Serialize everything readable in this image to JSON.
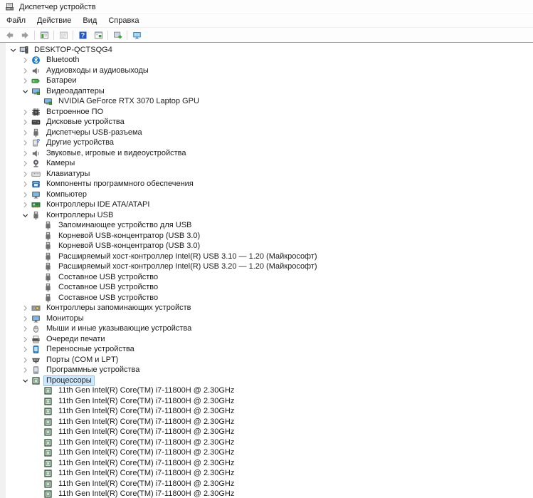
{
  "window": {
    "title": "Диспетчер устройств"
  },
  "menu": {
    "items": [
      {
        "name": "menu-file",
        "label": "Файл"
      },
      {
        "name": "menu-action",
        "label": "Действие"
      },
      {
        "name": "menu-view",
        "label": "Вид"
      },
      {
        "name": "menu-help",
        "label": "Справка"
      }
    ]
  },
  "toolbar": {
    "buttons": [
      {
        "type": "button",
        "name": "back-button",
        "icon": "back-arrow-icon",
        "disabled": true
      },
      {
        "type": "button",
        "name": "forward-button",
        "icon": "forward-arrow-icon",
        "disabled": true
      },
      {
        "type": "sep"
      },
      {
        "type": "button",
        "name": "console-tree-button",
        "icon": "console-tree-icon",
        "disabled": false
      },
      {
        "type": "sep"
      },
      {
        "type": "button",
        "name": "properties-button",
        "icon": "properties-disabled-icon",
        "disabled": true
      },
      {
        "type": "sep"
      },
      {
        "type": "button",
        "name": "help-button",
        "icon": "help-icon",
        "disabled": false
      },
      {
        "type": "button",
        "name": "properties-window-button",
        "icon": "properties-window-icon",
        "disabled": false
      },
      {
        "type": "sep"
      },
      {
        "type": "button",
        "name": "scan-hardware-button",
        "icon": "scan-hardware-icon",
        "disabled": false
      },
      {
        "type": "sep"
      },
      {
        "type": "button",
        "name": "device-monitor-button",
        "icon": "device-monitor-icon",
        "disabled": false
      }
    ]
  },
  "colors": {
    "selection_bg": "#cce8ff",
    "selection_border": "#8ec8f2",
    "toolbar_divider": "#9b9b9b",
    "help_blue": "#2457c5",
    "tree_bg": "#ffffff"
  },
  "tree": {
    "rows": [
      {
        "name": "desktop-qctsqg4",
        "label": "DESKTOP-QCTSQG4",
        "level": 0,
        "chevron": "expanded",
        "icon": "computer-icon"
      },
      {
        "name": "bluetooth",
        "label": "Bluetooth",
        "level": 1,
        "chevron": "collapsed",
        "icon": "bluetooth-icon"
      },
      {
        "name": "audio-inputs-outputs",
        "label": "Аудиовходы и аудиовыходы",
        "level": 1,
        "chevron": "collapsed",
        "icon": "audio-icon"
      },
      {
        "name": "batteries",
        "label": "Батареи",
        "level": 1,
        "chevron": "collapsed",
        "icon": "battery-icon"
      },
      {
        "name": "display-adapters",
        "label": "Видеоадаптеры",
        "level": 1,
        "chevron": "expanded",
        "icon": "display-adapter-icon"
      },
      {
        "name": "nvidia-rtx-3070",
        "label": "NVIDIA GeForce RTX 3070 Laptop GPU",
        "level": 2,
        "chevron": "none",
        "icon": "display-adapter-icon"
      },
      {
        "name": "firmware",
        "label": "Встроенное ПО",
        "level": 1,
        "chevron": "collapsed",
        "icon": "firmware-icon"
      },
      {
        "name": "disk-drives",
        "label": "Дисковые устройства",
        "level": 1,
        "chevron": "collapsed",
        "icon": "disk-drive-icon"
      },
      {
        "name": "usb-connector-managers",
        "label": "Диспетчеры USB-разъема",
        "level": 1,
        "chevron": "collapsed",
        "icon": "usb-icon"
      },
      {
        "name": "other-devices",
        "label": "Другие устройства",
        "level": 1,
        "chevron": "collapsed",
        "icon": "unknown-device-icon"
      },
      {
        "name": "sound-video-game",
        "label": "Звуковые, игровые и видеоустройства",
        "level": 1,
        "chevron": "collapsed",
        "icon": "audio-icon"
      },
      {
        "name": "cameras",
        "label": "Камеры",
        "level": 1,
        "chevron": "collapsed",
        "icon": "camera-icon"
      },
      {
        "name": "keyboards",
        "label": "Клавиатуры",
        "level": 1,
        "chevron": "collapsed",
        "icon": "keyboard-icon"
      },
      {
        "name": "software-components",
        "label": "Компоненты программного обеспечения",
        "level": 1,
        "chevron": "collapsed",
        "icon": "software-component-icon"
      },
      {
        "name": "computer",
        "label": "Компьютер",
        "level": 1,
        "chevron": "collapsed",
        "icon": "monitor-icon"
      },
      {
        "name": "ide-controllers",
        "label": "Контроллеры IDE ATA/ATAPI",
        "level": 1,
        "chevron": "collapsed",
        "icon": "ide-controller-icon"
      },
      {
        "name": "usb-controllers",
        "label": "Контроллеры USB",
        "level": 1,
        "chevron": "expanded",
        "icon": "usb-icon"
      },
      {
        "name": "usb-storage-device",
        "label": "Запоминающее устройство для USB",
        "level": 2,
        "chevron": "none",
        "icon": "usb-icon"
      },
      {
        "name": "usb-root-hub-1",
        "label": "Корневой USB-концентратор (USB 3.0)",
        "level": 2,
        "chevron": "none",
        "icon": "usb-icon"
      },
      {
        "name": "usb-root-hub-2",
        "label": "Корневой USB-концентратор (USB 3.0)",
        "level": 2,
        "chevron": "none",
        "icon": "usb-icon"
      },
      {
        "name": "usb-xhci-310",
        "label": "Расширяемый хост-контроллер Intel(R) USB 3.10 — 1.20 (Майкрософт)",
        "level": 2,
        "chevron": "none",
        "icon": "usb-icon"
      },
      {
        "name": "usb-xhci-320",
        "label": "Расширяемый хост-контроллер Intel(R) USB 3.20 — 1.20 (Майкрософт)",
        "level": 2,
        "chevron": "none",
        "icon": "usb-icon"
      },
      {
        "name": "usb-composite-1",
        "label": "Составное USB устройство",
        "level": 2,
        "chevron": "none",
        "icon": "usb-icon"
      },
      {
        "name": "usb-composite-2",
        "label": "Составное USB устройство",
        "level": 2,
        "chevron": "none",
        "icon": "usb-icon"
      },
      {
        "name": "usb-composite-3",
        "label": "Составное USB устройство",
        "level": 2,
        "chevron": "none",
        "icon": "usb-icon"
      },
      {
        "name": "storage-controllers",
        "label": "Контроллеры запоминающих устройств",
        "level": 1,
        "chevron": "collapsed",
        "icon": "storage-controller-icon"
      },
      {
        "name": "monitors",
        "label": "Мониторы",
        "level": 1,
        "chevron": "collapsed",
        "icon": "monitor-icon"
      },
      {
        "name": "mice",
        "label": "Мыши и иные указывающие устройства",
        "level": 1,
        "chevron": "collapsed",
        "icon": "mouse-icon"
      },
      {
        "name": "print-queues",
        "label": "Очереди печати",
        "level": 1,
        "chevron": "collapsed",
        "icon": "printer-icon"
      },
      {
        "name": "portable-devices",
        "label": "Переносные устройства",
        "level": 1,
        "chevron": "collapsed",
        "icon": "portable-device-icon"
      },
      {
        "name": "ports-com-lpt",
        "label": "Порты (COM и LPT)",
        "level": 1,
        "chevron": "collapsed",
        "icon": "port-icon"
      },
      {
        "name": "software-devices",
        "label": "Программные устройства",
        "level": 1,
        "chevron": "collapsed",
        "icon": "software-device-icon"
      },
      {
        "name": "processors",
        "label": "Процессоры",
        "level": 1,
        "chevron": "expanded",
        "icon": "cpu-icon",
        "selected": true
      },
      {
        "name": "cpu-1",
        "label": "11th Gen Intel(R) Core(TM) i7-11800H @ 2.30GHz",
        "level": 2,
        "chevron": "none",
        "icon": "cpu-icon"
      },
      {
        "name": "cpu-2",
        "label": "11th Gen Intel(R) Core(TM) i7-11800H @ 2.30GHz",
        "level": 2,
        "chevron": "none",
        "icon": "cpu-icon"
      },
      {
        "name": "cpu-3",
        "label": "11th Gen Intel(R) Core(TM) i7-11800H @ 2.30GHz",
        "level": 2,
        "chevron": "none",
        "icon": "cpu-icon"
      },
      {
        "name": "cpu-4",
        "label": "11th Gen Intel(R) Core(TM) i7-11800H @ 2.30GHz",
        "level": 2,
        "chevron": "none",
        "icon": "cpu-icon"
      },
      {
        "name": "cpu-5",
        "label": "11th Gen Intel(R) Core(TM) i7-11800H @ 2.30GHz",
        "level": 2,
        "chevron": "none",
        "icon": "cpu-icon"
      },
      {
        "name": "cpu-6",
        "label": "11th Gen Intel(R) Core(TM) i7-11800H @ 2.30GHz",
        "level": 2,
        "chevron": "none",
        "icon": "cpu-icon"
      },
      {
        "name": "cpu-7",
        "label": "11th Gen Intel(R) Core(TM) i7-11800H @ 2.30GHz",
        "level": 2,
        "chevron": "none",
        "icon": "cpu-icon"
      },
      {
        "name": "cpu-8",
        "label": "11th Gen Intel(R) Core(TM) i7-11800H @ 2.30GHz",
        "level": 2,
        "chevron": "none",
        "icon": "cpu-icon"
      },
      {
        "name": "cpu-9",
        "label": "11th Gen Intel(R) Core(TM) i7-11800H @ 2.30GHz",
        "level": 2,
        "chevron": "none",
        "icon": "cpu-icon"
      },
      {
        "name": "cpu-10",
        "label": "11th Gen Intel(R) Core(TM) i7-11800H @ 2.30GHz",
        "level": 2,
        "chevron": "none",
        "icon": "cpu-icon"
      },
      {
        "name": "cpu-11",
        "label": "11th Gen Intel(R) Core(TM) i7-11800H @ 2.30GHz",
        "level": 2,
        "chevron": "none",
        "icon": "cpu-icon"
      }
    ]
  }
}
